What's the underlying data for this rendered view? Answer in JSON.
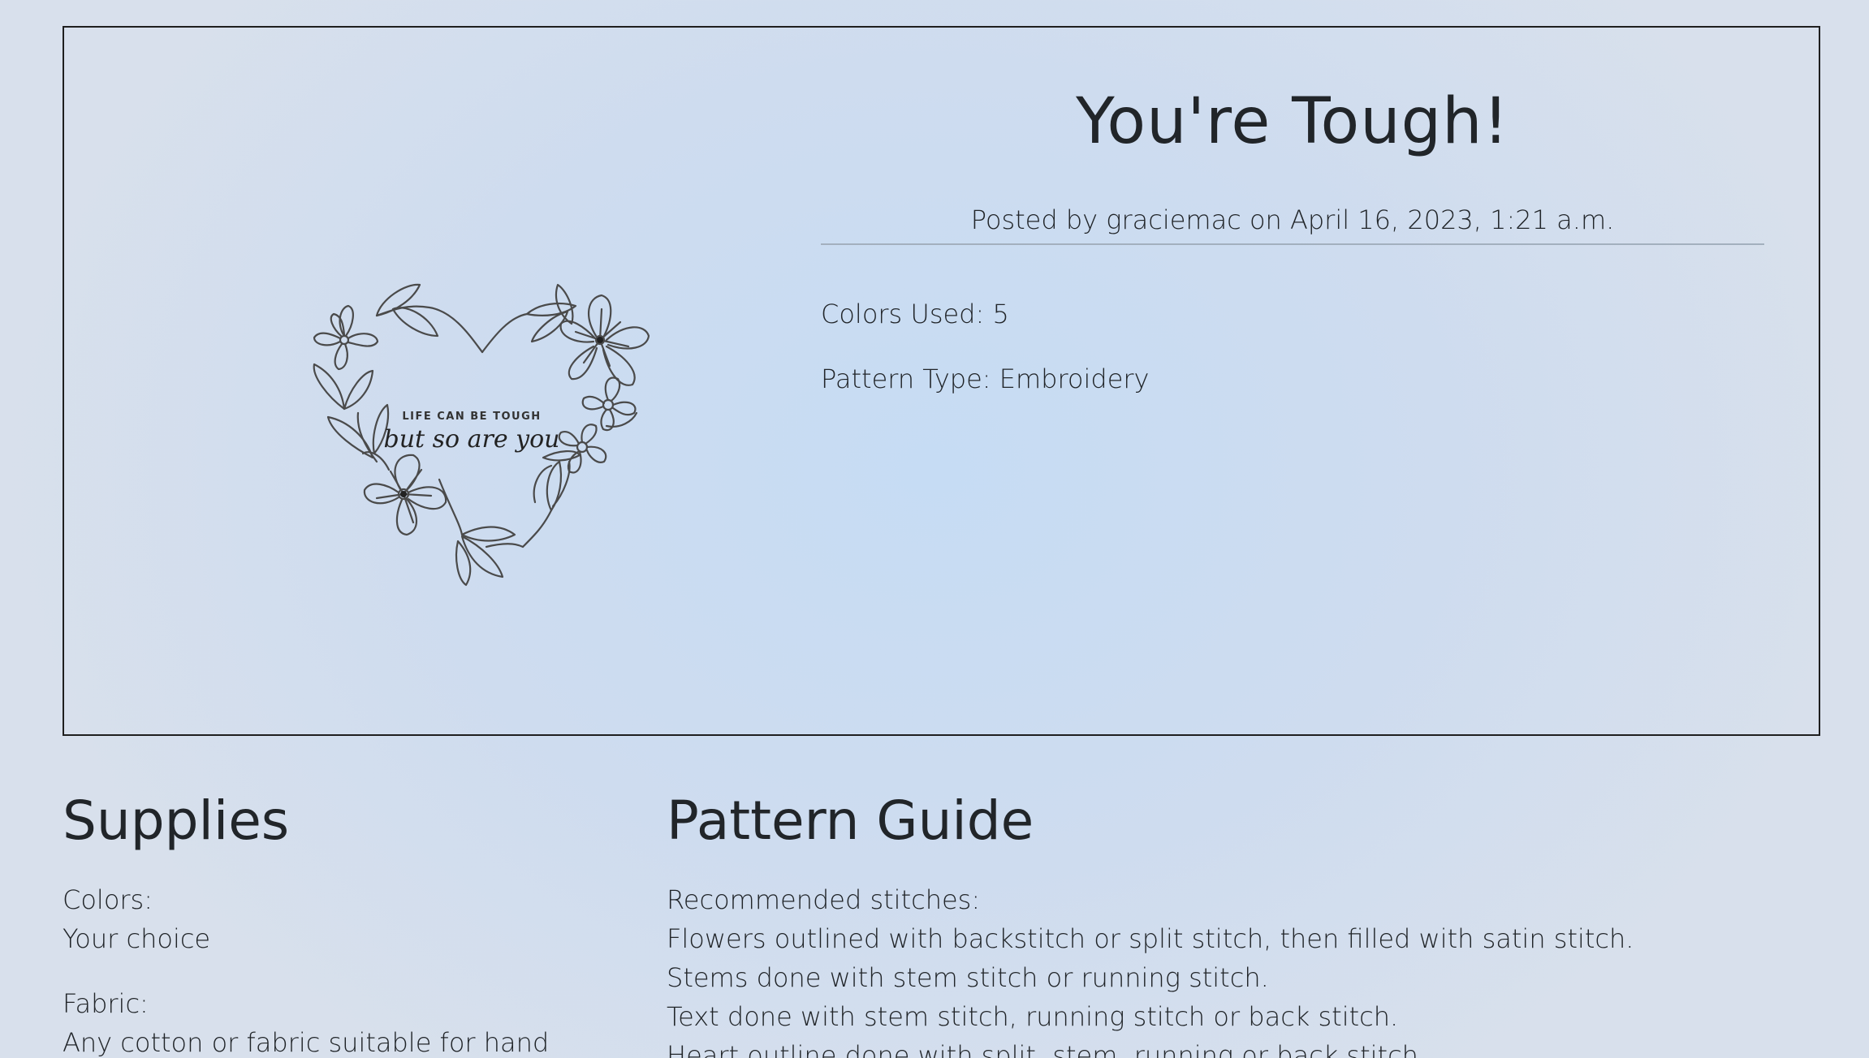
{
  "pattern": {
    "title": "You're Tough!",
    "posted_by": "Posted by graciemac on April 16, 2023, 1:21 a.m.",
    "colors_used": "Colors Used: 5",
    "pattern_type": "Pattern Type: Embroidery",
    "image": {
      "small_text": "LIFE CAN BE TOUGH",
      "script_text": "but so are you"
    }
  },
  "supplies": {
    "heading": "Supplies",
    "colors_label": "Colors:",
    "colors_value": "Your choice",
    "fabric_label": "Fabric:",
    "fabric_value": "Any cotton or fabric suitable for hand"
  },
  "guide": {
    "heading": "Pattern Guide",
    "lines": [
      "Recommended stitches:",
      "Flowers outlined with backstitch or split stitch, then filled with satin stitch.",
      "Stems done with stem stitch or running stitch.",
      "Text done with stem stitch, running stitch or back stitch.",
      "Heart outline done with split, stem, running or back stitch."
    ]
  },
  "colors": {
    "text": "#212529",
    "background": "#cedcef",
    "border": "#1f1f1f",
    "divider": "#a3b0be"
  }
}
